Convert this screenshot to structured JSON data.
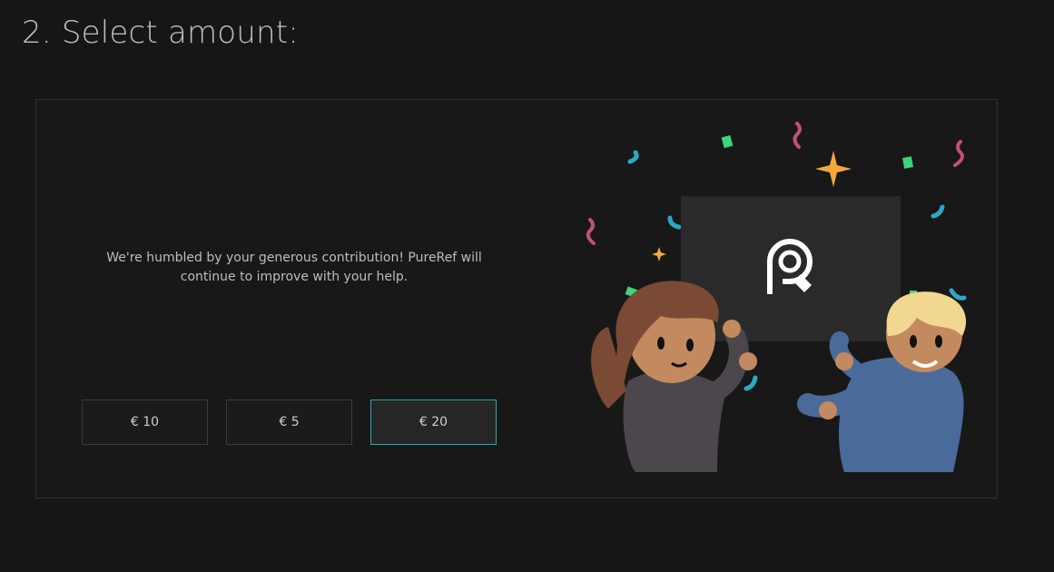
{
  "heading": "2. Select amount:",
  "message": "We're humbled by your generous contribution! PureRef will continue to improve with your help.",
  "amounts": [
    {
      "label": "€ 10",
      "selected": false
    },
    {
      "label": "€ 5",
      "selected": false
    },
    {
      "label": "€ 20",
      "selected": true
    }
  ],
  "colors": {
    "background": "#161616",
    "panel_border": "#303030",
    "selected_border": "#2aa9ae",
    "text": "#bdbdbd"
  },
  "illustration": {
    "icons": [
      "pureref-logo-icon",
      "confetti-icon",
      "sparkle-icon",
      "girl-character",
      "boy-character"
    ]
  }
}
